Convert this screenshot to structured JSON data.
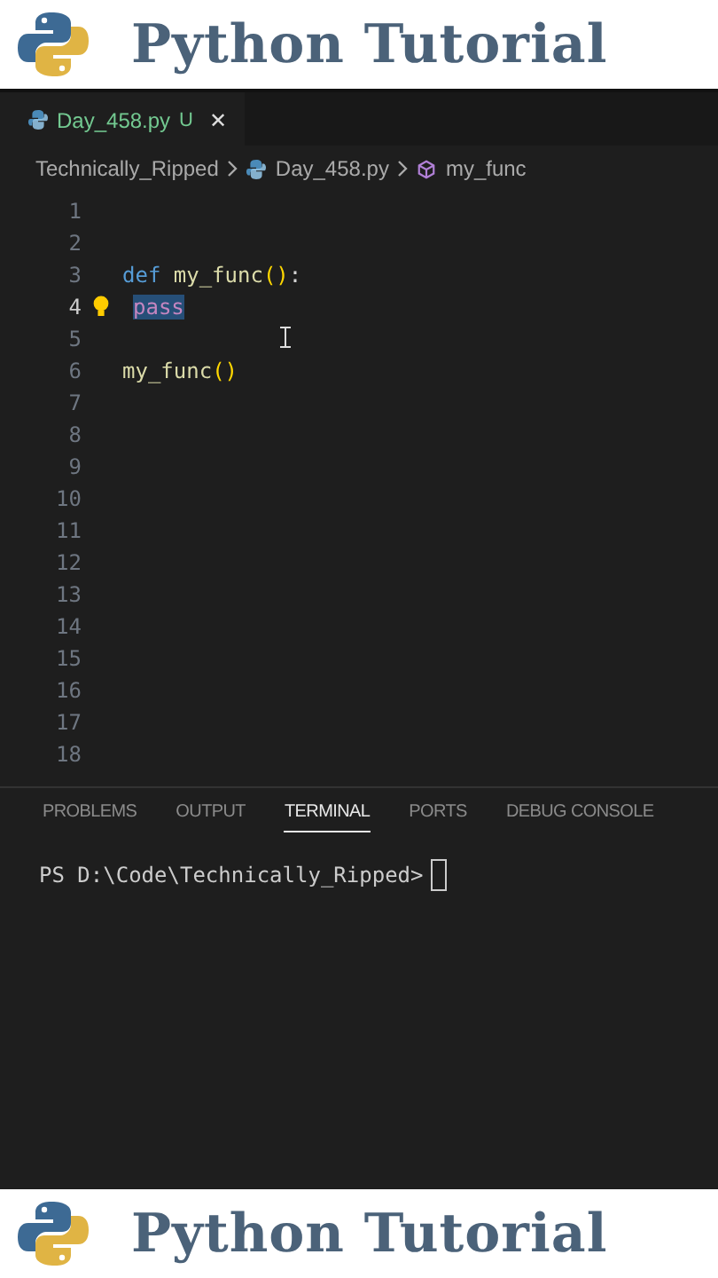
{
  "top_banner": {
    "title": "Python Tutorial"
  },
  "editor_tab": {
    "filename": "Day_458.py",
    "status": "U",
    "close": "✕",
    "selected": true
  },
  "breadcrumb": [
    {
      "kind": "folder",
      "text": "Technically_Ripped"
    },
    {
      "kind": "file",
      "text": "Day_458.py"
    },
    {
      "kind": "symbol",
      "text": "my_func"
    }
  ],
  "code_lines": [
    {
      "number": "1",
      "active": false,
      "hint": false
    },
    {
      "number": "2",
      "active": false,
      "hint": false
    },
    {
      "number": "3",
      "active": false,
      "hint": false,
      "tokens": [
        {
          "kind": "keyword",
          "text": "def"
        },
        {
          "kind": "function",
          "text": "my_func"
        },
        {
          "kind": "bracket",
          "text": "()"
        },
        {
          "kind": "plain",
          "text": ":"
        }
      ]
    },
    {
      "number": "4",
      "active": true,
      "hint": true,
      "tokens": [
        {
          "kind": "control",
          "text": "pass",
          "selected": true
        }
      ]
    },
    {
      "number": "5",
      "active": false,
      "hint": false
    },
    {
      "number": "6",
      "active": false,
      "hint": false,
      "tokens": [
        {
          "kind": "function",
          "text": "my_func"
        },
        {
          "kind": "bracket",
          "text": "()"
        }
      ]
    },
    {
      "number": "7",
      "active": false,
      "hint": false
    },
    {
      "number": "8",
      "active": false,
      "hint": false
    },
    {
      "number": "9",
      "active": false,
      "hint": false
    },
    {
      "number": "10",
      "active": false,
      "hint": false
    },
    {
      "number": "11",
      "active": false,
      "hint": false
    },
    {
      "number": "12",
      "active": false,
      "hint": false
    },
    {
      "number": "13",
      "active": false,
      "hint": false
    },
    {
      "number": "14",
      "active": false,
      "hint": false
    },
    {
      "number": "15",
      "active": false,
      "hint": false
    },
    {
      "number": "16",
      "active": false,
      "hint": false
    },
    {
      "number": "17",
      "active": false,
      "hint": false
    },
    {
      "number": "18",
      "active": false,
      "hint": false
    }
  ],
  "panel_tabs": [
    {
      "label": "PROBLEMS",
      "selected": false
    },
    {
      "label": "OUTPUT",
      "selected": false
    },
    {
      "label": "TERMINAL",
      "selected": true
    },
    {
      "label": "PORTS",
      "selected": false
    },
    {
      "label": "DEBUG CONSOLE",
      "selected": false
    }
  ],
  "terminal": {
    "prompt": "PS D:\\Code\\Technically_Ripped>"
  },
  "bottom_banner": {
    "title": "Python Tutorial"
  }
}
